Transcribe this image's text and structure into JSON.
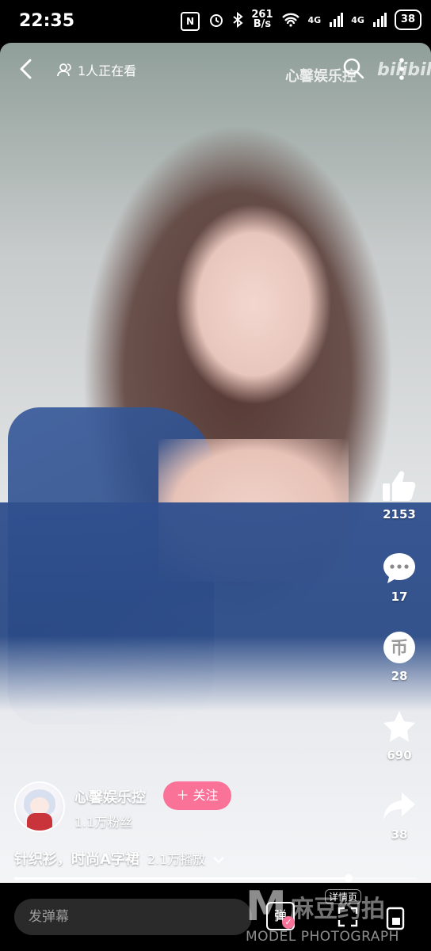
{
  "status_bar": {
    "time": "22:35",
    "nfc": "N",
    "network_speed_value": "261",
    "network_speed_unit": "B/s",
    "signal1": "4G",
    "signal2": "4G",
    "battery": "38"
  },
  "top_bar": {
    "viewers": "1人正在看",
    "watermark_name": "心馨娱乐控",
    "watermark_logo": "bilibili"
  },
  "actions": {
    "likes": "2153",
    "comments": "17",
    "coins": "28",
    "favorites": "690",
    "shares": "38"
  },
  "author": {
    "name": "心馨娱乐控",
    "followers": "1.1万粉丝",
    "follow_label": "＋ 关注"
  },
  "video": {
    "title": "针织衫，时尚A字裙",
    "play_count": "2.1万播放",
    "progress_fraction": 0.83
  },
  "bottom_bar": {
    "danmaku_placeholder": "发弹幕",
    "danmaku_toggle": "弹",
    "details_label": "详情页",
    "brand_m": "M",
    "brand_cn": "麻豆约拍",
    "brand_en": "MODEL PHOTOGRAPH"
  },
  "colors": {
    "accent": "#fb7299"
  }
}
